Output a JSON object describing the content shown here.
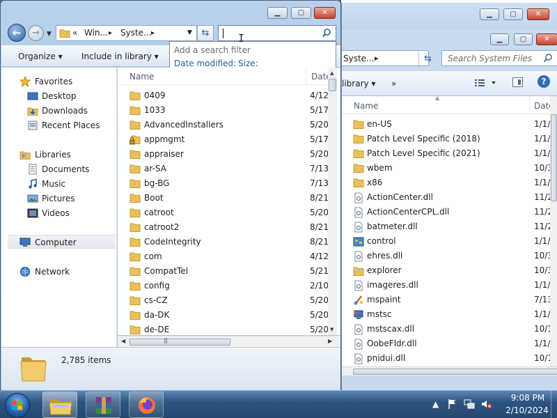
{
  "back_window": {
    "address": {
      "current": "Syste...",
      "sep": "▸"
    },
    "search_placeholder": "Search System Files",
    "toolbar": {
      "library": "library ▾",
      "more": "»"
    },
    "columns": {
      "name": "Name",
      "date": "Date"
    },
    "rows": [
      {
        "name": "en-US",
        "date": "1/1/",
        "icon": "folder-icon"
      },
      {
        "name": "Patch Level Specific (2018)",
        "date": "1/1/",
        "icon": "folder-icon"
      },
      {
        "name": "Patch Level Specific (2021)",
        "date": "1/1/",
        "icon": "folder-icon"
      },
      {
        "name": "wbem",
        "date": "10/3",
        "icon": "folder-icon"
      },
      {
        "name": "x86",
        "date": "1/1/",
        "icon": "folder-icon"
      },
      {
        "name": "ActionCenter.dll",
        "date": "11/2",
        "icon": "dll-icon"
      },
      {
        "name": "ActionCenterCPL.dll",
        "date": "11/2",
        "icon": "dll-icon"
      },
      {
        "name": "batmeter.dll",
        "date": "11/2",
        "icon": "dll-icon"
      },
      {
        "name": "control",
        "date": "1/1/",
        "icon": "control-panel-icon"
      },
      {
        "name": "ehres.dll",
        "date": "10/3",
        "icon": "dll-icon"
      },
      {
        "name": "explorer",
        "date": "10/3",
        "icon": "explorer-icon"
      },
      {
        "name": "imageres.dll",
        "date": "1/1/",
        "icon": "dll-icon"
      },
      {
        "name": "mspaint",
        "date": "7/13",
        "icon": "paint-icon"
      },
      {
        "name": "mstsc",
        "date": "1/1/",
        "icon": "remote-desktop-icon"
      },
      {
        "name": "mstscax.dll",
        "date": "10/1",
        "icon": "dll-icon"
      },
      {
        "name": "OobeFldr.dll",
        "date": "1/1/",
        "icon": "dll-icon"
      },
      {
        "name": "pnidui.dll",
        "date": "10/1",
        "icon": "dll-icon"
      }
    ]
  },
  "front_window": {
    "address": {
      "chevrons": "«",
      "part1": "Win...",
      "part2": "Syste...",
      "sep": "▸"
    },
    "search_value": "",
    "search_dropdown": {
      "hint": "Add a search filter",
      "filters": [
        "Date modified:",
        "Size:"
      ]
    },
    "toolbar": {
      "organize": "Organize ▾",
      "include": "Include in library ▾"
    },
    "nav": {
      "favorites": "Favorites",
      "desktop": "Desktop",
      "downloads": "Downloads",
      "recent": "Recent Places",
      "libraries": "Libraries",
      "documents": "Documents",
      "music": "Music",
      "pictures": "Pictures",
      "videos": "Videos",
      "computer": "Computer",
      "network": "Network"
    },
    "columns": {
      "name": "Name",
      "date": "Date"
    },
    "rows": [
      {
        "name": "0409",
        "date": "4/12",
        "icon": "folder-icon"
      },
      {
        "name": "1033",
        "date": "5/17",
        "icon": "folder-icon"
      },
      {
        "name": "AdvancedInstallers",
        "date": "5/20",
        "icon": "folder-icon"
      },
      {
        "name": "appmgmt",
        "date": "5/17",
        "icon": "locked-folder-icon"
      },
      {
        "name": "appraiser",
        "date": "5/20",
        "icon": "folder-icon"
      },
      {
        "name": "ar-SA",
        "date": "7/13",
        "icon": "folder-icon"
      },
      {
        "name": "bg-BG",
        "date": "7/13",
        "icon": "folder-icon"
      },
      {
        "name": "Boot",
        "date": "8/21",
        "icon": "folder-icon"
      },
      {
        "name": "catroot",
        "date": "5/20",
        "icon": "folder-icon"
      },
      {
        "name": "catroot2",
        "date": "8/21",
        "icon": "folder-icon"
      },
      {
        "name": "CodeIntegrity",
        "date": "8/21",
        "icon": "folder-icon"
      },
      {
        "name": "com",
        "date": "4/12",
        "icon": "folder-icon"
      },
      {
        "name": "CompatTel",
        "date": "5/21",
        "icon": "folder-icon"
      },
      {
        "name": "config",
        "date": "2/10",
        "icon": "folder-icon"
      },
      {
        "name": "cs-CZ",
        "date": "5/20",
        "icon": "folder-icon"
      },
      {
        "name": "da-DK",
        "date": "5/20",
        "icon": "folder-icon"
      },
      {
        "name": "de-DE",
        "date": "5/20",
        "icon": "folder-icon"
      }
    ],
    "status": {
      "count": "2,785 items"
    }
  },
  "taskbar": {
    "time": "9:08 PM",
    "date": "2/10/2024"
  },
  "colors": {
    "folder": "#e8c15a",
    "folder_dark": "#c99a2e",
    "link": "#2a5ba6",
    "close": "#c7452f"
  }
}
